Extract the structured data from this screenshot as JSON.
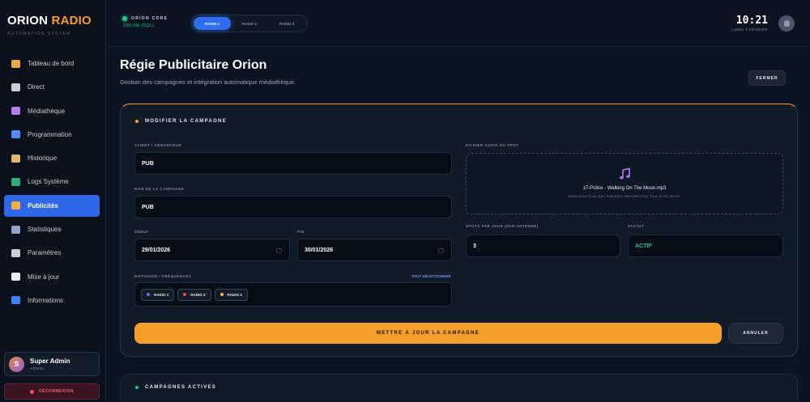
{
  "brand": {
    "title_main": "ORION",
    "title_accent": "RADIO",
    "subtitle": "AUTOMATION SYSTEM"
  },
  "sidebar": {
    "items": [
      {
        "label": "Tableau de bord",
        "icon": "dashboard-icon",
        "color": "#e9a94a"
      },
      {
        "label": "Direct",
        "icon": "microphone-icon",
        "color": "#c9cfd8"
      },
      {
        "label": "Médiathèque",
        "icon": "music-icon",
        "color": "#b57be8"
      },
      {
        "label": "Programmation",
        "icon": "calendar-icon",
        "color": "#4c8ff2"
      },
      {
        "label": "Historique",
        "icon": "scroll-icon",
        "color": "#e3b46a"
      },
      {
        "label": "Logs Système",
        "icon": "terminal-icon",
        "color": "#2fae7a"
      },
      {
        "label": "Publicités",
        "icon": "money-bag-icon",
        "color": "#f0b040"
      },
      {
        "label": "Statistiques",
        "icon": "chart-icon",
        "color": "#8fa6c6"
      },
      {
        "label": "Paramètres",
        "icon": "gear-icon",
        "color": "#c9cfd8"
      },
      {
        "label": "Mise à jour",
        "icon": "cloud-icon",
        "color": "#e6ebf3"
      },
      {
        "label": "Informations",
        "icon": "info-icon",
        "color": "#3b82f6"
      }
    ],
    "active_index": 6,
    "user": {
      "initial": "S",
      "name": "Super Admin",
      "role": "ADMIN"
    },
    "logout_label": "DÉCONNEXION"
  },
  "topbar": {
    "core_title": "ORION CORE",
    "core_status": "ONLINE (SQL)",
    "tabs": [
      "RADIO 1",
      "RADIO 2",
      "RADIO 3"
    ],
    "active_tab": 0,
    "time": "10:21",
    "date": "LUNDI 2 FÉVRIER"
  },
  "page": {
    "title": "Régie Publicitaire Orion",
    "subtitle": "Gestion des campagnes et intégration automatique médiathèque.",
    "close_label": "FERMER"
  },
  "form": {
    "heading": "MODIFIER LA CAMPAGNE",
    "client_label": "CLIENT / ANNONCEUR",
    "client_value": "PUB",
    "campaign_label": "NOM DE LA CAMPAGNE",
    "campaign_value": "PUB",
    "start_label": "DÉBUT",
    "start_value": "29/01/2026",
    "end_label": "FIN",
    "end_value": "30/01/2026",
    "diffusion_label": "DIFFUSION / FRÉQUENCES",
    "select_all_label": "TOUT SÉLECTIONNER",
    "stations": [
      {
        "label": "RADIO 1",
        "color": "#3b82f6"
      },
      {
        "label": "RADIO 2",
        "color": "#ef4444"
      },
      {
        "label": "RADIO 3",
        "color": "#f5b82a"
      }
    ],
    "audio_label": "FICHIER AUDIO DU SPOT",
    "audio_file": "17-Police - Walking On The Moon.mp3",
    "audio_hint": "SERA AJOUTÉ AU BAC PUB AVEC RESTRICTION \"PAS 2X DE SUITE\"",
    "spots_label": "SPOTS PAR JOUR (PAR ANTENNE)",
    "spots_value": "3",
    "status_label": "STATUT",
    "status_value": "ACTIF",
    "submit_label": "METTRE À JOUR LA CAMPAGNE",
    "cancel_label": "ANNULER"
  },
  "active_campaigns": {
    "heading": "CAMPAGNES ACTIVES"
  },
  "colors": {
    "accent": "#f59e2a",
    "primary": "#2e67e8",
    "success": "#28c787",
    "danger": "#ff4d68"
  }
}
